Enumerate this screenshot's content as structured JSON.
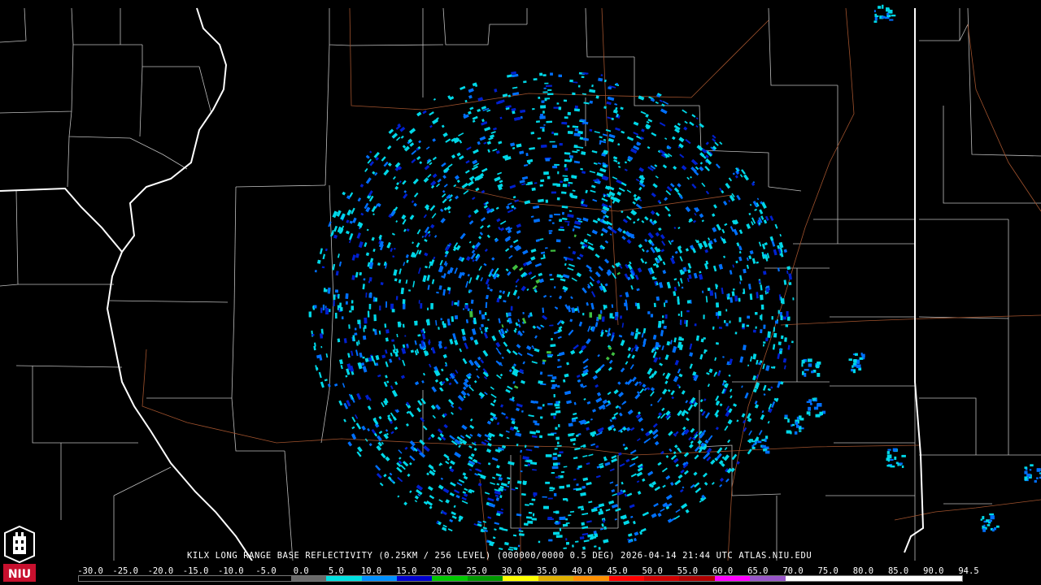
{
  "caption": {
    "station": "KILX",
    "product": "LONG RANGE BASE REFLECTIVITY",
    "resolution": "(0.25KM / 256 LEVEL)",
    "elevation": "(000000/0000 0.5 DEG)",
    "timestamp": "2026-04-14 21:44 UTC",
    "source": "ATLAS.NIU.EDU"
  },
  "logo": {
    "text": "NIU",
    "color": "#c8102e"
  },
  "legend": {
    "values": [
      "-30.0",
      "-25.0",
      "-20.0",
      "-15.0",
      "-10.0",
      "-5.0",
      "0.0",
      "5.0",
      "10.0",
      "15.0",
      "20.0",
      "25.0",
      "30.0",
      "35.0",
      "40.0",
      "45.0",
      "50.0",
      "55.0",
      "60.0",
      "65.0",
      "70.0",
      "75.0",
      "80.0",
      "85.0",
      "90.0",
      "94.5"
    ],
    "colors": [
      "#000000",
      "#000000",
      "#000000",
      "#000000",
      "#000000",
      "#000000",
      "#6a6a6a",
      "#00e0e0",
      "#0090ff",
      "#0000d0",
      "#00c800",
      "#009800",
      "#ffff00",
      "#e0b000",
      "#ff9000",
      "#ff0000",
      "#d00000",
      "#b00000",
      "#ff00ff",
      "#9955c9",
      "#ffffff",
      "#ffffff",
      "#ffffff",
      "#ffffff",
      "#ffffff"
    ]
  },
  "colors": {
    "background": "#000000",
    "county_border": "#bdbdbd",
    "state_border": "#ffffff",
    "highway": "#a0522d",
    "echo_light": "#00d8e8",
    "echo_mid": "#0070ff",
    "echo_strong": "#0020d0",
    "echo_green": "#40c040"
  },
  "radar": {
    "station": "KILX"
  }
}
